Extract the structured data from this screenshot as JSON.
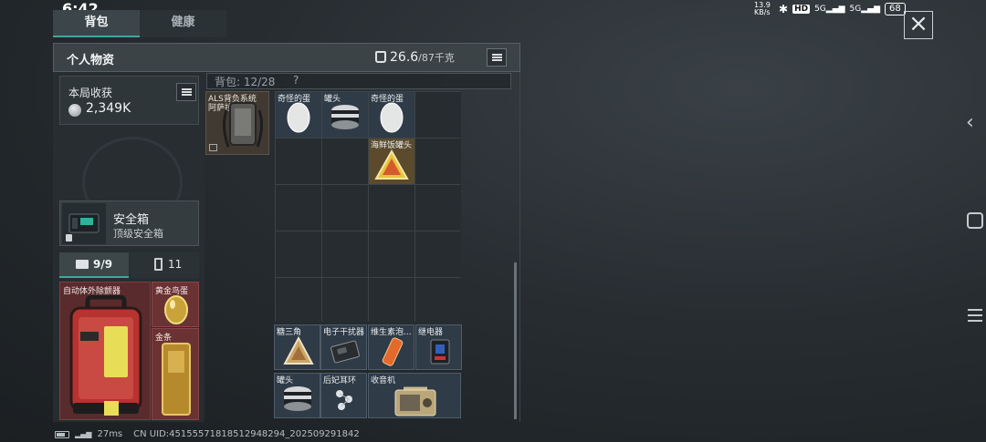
{
  "status_bar": {
    "time": "6:42",
    "net_speed": "13.9 KB/s",
    "hd_badge": "HD",
    "signal_1": "5G",
    "signal_2": "5G",
    "battery": "68"
  },
  "tabs": [
    {
      "label": "背包",
      "active": true
    },
    {
      "label": "健康",
      "active": false
    }
  ],
  "panel": {
    "title": "个人物资",
    "weight_current": "26.6",
    "weight_max": "/87千克",
    "weight_icon": "weight-icon"
  },
  "harvest": {
    "label": "本局收获",
    "value": "2,349K"
  },
  "safebox": {
    "title": "安全箱",
    "subtitle": "顶级安全箱"
  },
  "case_tabs": {
    "kit_count": "9/9",
    "ammo_count": "11"
  },
  "safe_items": {
    "aed": "自动体外除颤器",
    "gold_egg": "黄金鸟蛋",
    "gold_bar": "金条"
  },
  "backpack": {
    "capacity": "背包: 12/28",
    "help": "?",
    "als": "ALS背负系统",
    "als_sub": "阿萨拉",
    "grid_items": {
      "r0c0": "奇怪的蛋",
      "r0c1": "罐头",
      "r0c2": "奇怪的蛋",
      "r1c2": "海鲜饭罐头"
    },
    "lower_items": {
      "sugar_triangle": "糖三角",
      "jammer": "电子干扰器",
      "vitamin": "维生素泡...",
      "relay": "继电器",
      "can": "罐头",
      "earring": "后妃耳环",
      "radio": "收音机"
    }
  },
  "footer": {
    "ping": "27ms",
    "uid": "CN UID:4515557181851294829​4_202509291842"
  },
  "colors": {
    "accent": "#3ea7a0",
    "red_slot": "#5a2b2c",
    "blue_slot": "#2f3b47",
    "gold_slot": "#5b4a2c"
  }
}
